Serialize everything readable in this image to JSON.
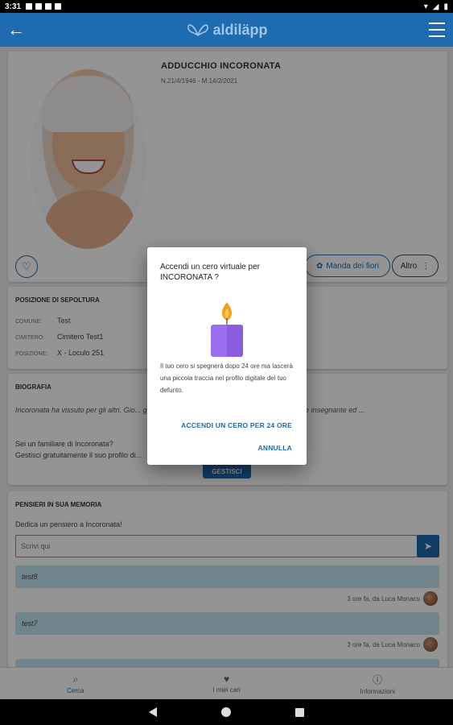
{
  "statusbar": {
    "time": "3:31"
  },
  "appbar": {
    "logo_text": "aldiläpp"
  },
  "profile": {
    "name": "ADDUCCHIO INCORONATA",
    "dates": "N.21/4/1946 - M.14/2/2021",
    "flowers_label": "Manda dei fiori",
    "other_label": "Altro"
  },
  "burial": {
    "title": "POSIZIONE DI SEPOLTURA",
    "rows": [
      {
        "key": "COMUNE:",
        "value": "Test"
      },
      {
        "key": "CIMITERO:",
        "value": "Cimitero Test1"
      },
      {
        "key": "POSIZIONE:",
        "value": "X - Loculo 251"
      }
    ]
  },
  "bio": {
    "title": "BIOGRAFIA",
    "text": "Incoronata ha vissuto per gli altri. Gio... gli studi universitari gli hanno permesso di diventare insegnante ed ...",
    "question_line1": "Sei un familiare di Incoronata?",
    "question_line2": "Gestisci gratuitamente il suo profilo di...",
    "manage_label": "GESTISCI"
  },
  "thoughts": {
    "title": "PENSIERI IN SUA MEMORIA",
    "hint": "Dedica un pensiero a Incoronata!",
    "input_placeholder": "Scrivi qui",
    "messages": [
      {
        "text": "test8",
        "meta": "3 ore fa, da Luca Monaco"
      },
      {
        "text": "test7",
        "meta": "3 ore fa, da Luca Monaco"
      }
    ]
  },
  "bottomnav": {
    "items": [
      {
        "label": "Cerca",
        "icon": "search-icon"
      },
      {
        "label": "I miei cari",
        "icon": "heart-icon"
      },
      {
        "label": "Informazioni",
        "icon": "info-icon"
      }
    ]
  },
  "dialog": {
    "title": "Accendi un cero virtuale per INCORONATA ?",
    "body": "Il tuo cero si spegnerà dopo 24 ore ma lascerà una piccola traccia nel profilo digitale del tuo defunto.",
    "confirm_label": "ACCENDI UN CERO PER 24 ORE",
    "cancel_label": "ANNULLA"
  },
  "colors": {
    "primary": "#1e6bb0",
    "candle": "#9b6ef0",
    "flame": "#f2a11f",
    "message_bg": "#bfe4f0"
  }
}
